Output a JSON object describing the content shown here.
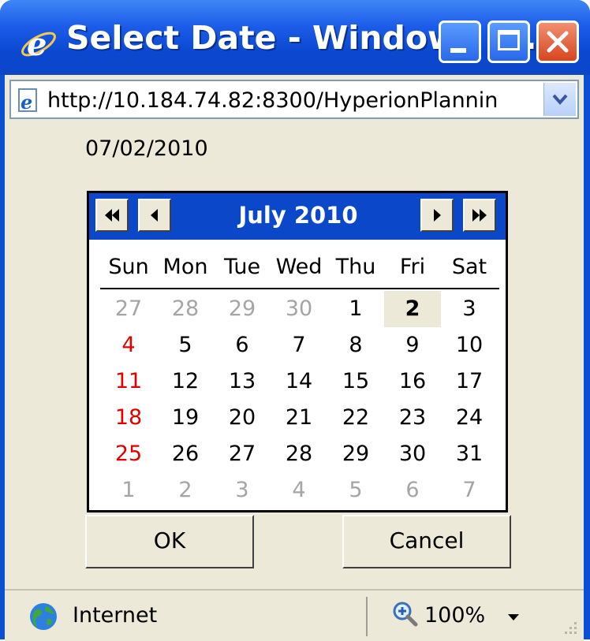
{
  "window": {
    "title": "Select Date - Windows I...",
    "address": "http://10.184.74.82:8300/HyperionPlannin"
  },
  "date_value": "07/02/2010",
  "calendar": {
    "month_title": "July 2010",
    "weekdays": [
      "Sun",
      "Mon",
      "Tue",
      "Wed",
      "Thu",
      "Fri",
      "Sat"
    ],
    "weeks": [
      [
        "27",
        "28",
        "29",
        "30",
        "1",
        "2",
        "3"
      ],
      [
        "4",
        "5",
        "6",
        "7",
        "8",
        "9",
        "10"
      ],
      [
        "11",
        "12",
        "13",
        "14",
        "15",
        "16",
        "17"
      ],
      [
        "18",
        "19",
        "20",
        "21",
        "22",
        "23",
        "24"
      ],
      [
        "25",
        "26",
        "27",
        "28",
        "29",
        "30",
        "31"
      ],
      [
        "1",
        "2",
        "3",
        "4",
        "5",
        "6",
        "7"
      ]
    ],
    "selected_day": "2"
  },
  "buttons": {
    "ok": "OK",
    "cancel": "Cancel"
  },
  "status": {
    "zone": "Internet",
    "zoom": "100%"
  },
  "colors": {
    "titlebar": "#0b4fd4",
    "calendar_header": "#0b47c9",
    "sunday": "#e00000",
    "other_month": "#a5a5a5",
    "face": "#ece9d8"
  }
}
